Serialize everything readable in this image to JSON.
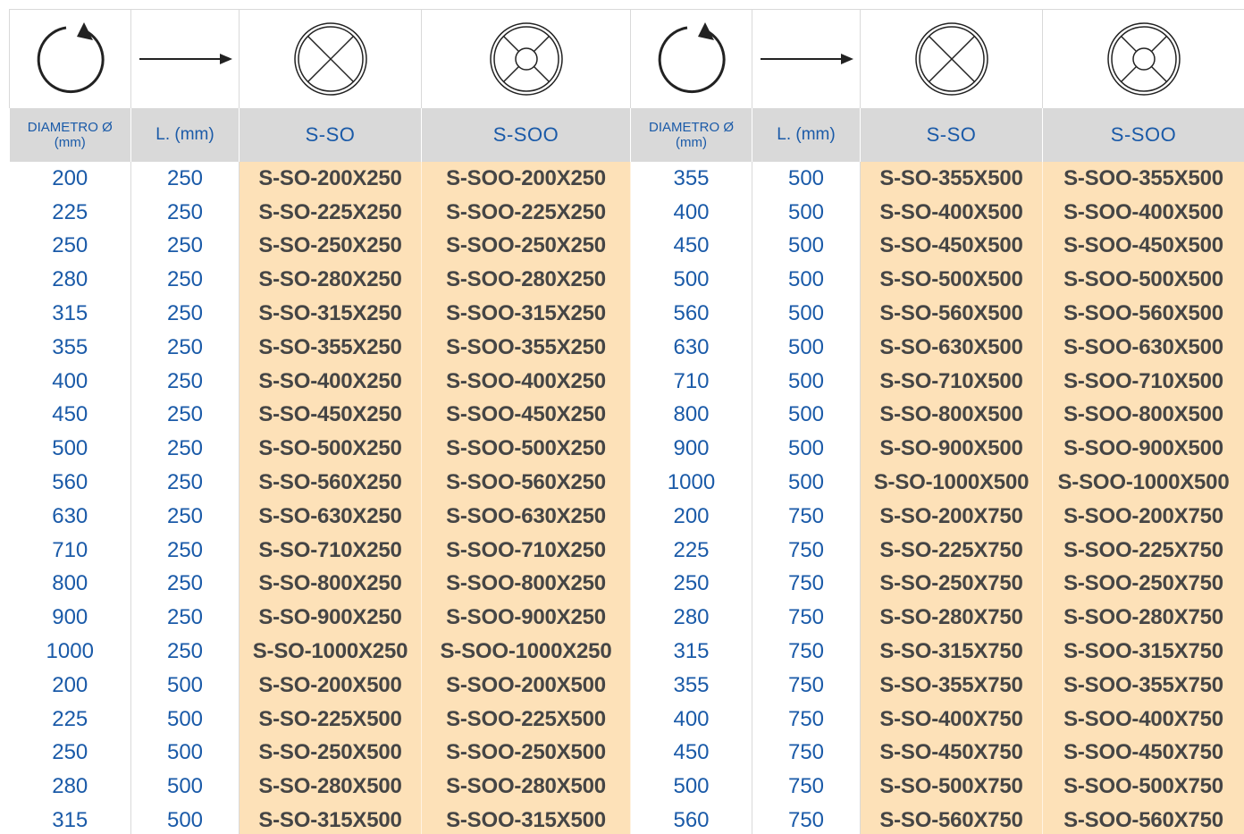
{
  "header": {
    "icons": [
      {
        "name": "rotation-arrow-icon"
      },
      {
        "name": "length-arrow-icon"
      },
      {
        "name": "cross-damper-icon"
      },
      {
        "name": "round-cross-damper-icon"
      },
      {
        "name": "rotation-arrow-icon"
      },
      {
        "name": "length-arrow-icon"
      },
      {
        "name": "cross-damper-icon"
      },
      {
        "name": "round-cross-damper-icon"
      }
    ],
    "labels": [
      {
        "line1": "DIAMETRO Ø",
        "line2": "(mm)"
      },
      {
        "text": "L. (mm)"
      },
      {
        "text": "S-SO"
      },
      {
        "text": "S-SOO"
      },
      {
        "line1": "DIAMETRO Ø",
        "line2": "(mm)"
      },
      {
        "text": "L. (mm)"
      },
      {
        "text": "S-SO"
      },
      {
        "text": "S-SOO"
      }
    ]
  },
  "colors": {
    "accent_blue": "#1a5aa8",
    "header_gray": "#d9d9d9",
    "code_background": "#fde1b8",
    "code_text": "#454545"
  },
  "rows": [
    [
      "200",
      "250",
      "S-SO-200X250",
      "S-SOO-200X250",
      "355",
      "500",
      "S-SO-355X500",
      "S-SOO-355X500"
    ],
    [
      "225",
      "250",
      "S-SO-225X250",
      "S-SOO-225X250",
      "400",
      "500",
      "S-SO-400X500",
      "S-SOO-400X500"
    ],
    [
      "250",
      "250",
      "S-SO-250X250",
      "S-SOO-250X250",
      "450",
      "500",
      "S-SO-450X500",
      "S-SOO-450X500"
    ],
    [
      "280",
      "250",
      "S-SO-280X250",
      "S-SOO-280X250",
      "500",
      "500",
      "S-SO-500X500",
      "S-SOO-500X500"
    ],
    [
      "315",
      "250",
      "S-SO-315X250",
      "S-SOO-315X250",
      "560",
      "500",
      "S-SO-560X500",
      "S-SOO-560X500"
    ],
    [
      "355",
      "250",
      "S-SO-355X250",
      "S-SOO-355X250",
      "630",
      "500",
      "S-SO-630X500",
      "S-SOO-630X500"
    ],
    [
      "400",
      "250",
      "S-SO-400X250",
      "S-SOO-400X250",
      "710",
      "500",
      "S-SO-710X500",
      "S-SOO-710X500"
    ],
    [
      "450",
      "250",
      "S-SO-450X250",
      "S-SOO-450X250",
      "800",
      "500",
      "S-SO-800X500",
      "S-SOO-800X500"
    ],
    [
      "500",
      "250",
      "S-SO-500X250",
      "S-SOO-500X250",
      "900",
      "500",
      "S-SO-900X500",
      "S-SOO-900X500"
    ],
    [
      "560",
      "250",
      "S-SO-560X250",
      "S-SOO-560X250",
      "1000",
      "500",
      "S-SO-1000X500",
      "S-SOO-1000X500"
    ],
    [
      "630",
      "250",
      "S-SO-630X250",
      "S-SOO-630X250",
      "200",
      "750",
      "S-SO-200X750",
      "S-SOO-200X750"
    ],
    [
      "710",
      "250",
      "S-SO-710X250",
      "S-SOO-710X250",
      "225",
      "750",
      "S-SO-225X750",
      "S-SOO-225X750"
    ],
    [
      "800",
      "250",
      "S-SO-800X250",
      "S-SOO-800X250",
      "250",
      "750",
      "S-SO-250X750",
      "S-SOO-250X750"
    ],
    [
      "900",
      "250",
      "S-SO-900X250",
      "S-SOO-900X250",
      "280",
      "750",
      "S-SO-280X750",
      "S-SOO-280X750"
    ],
    [
      "1000",
      "250",
      "S-SO-1000X250",
      "S-SOO-1000X250",
      "315",
      "750",
      "S-SO-315X750",
      "S-SOO-315X750"
    ],
    [
      "200",
      "500",
      "S-SO-200X500",
      "S-SOO-200X500",
      "355",
      "750",
      "S-SO-355X750",
      "S-SOO-355X750"
    ],
    [
      "225",
      "500",
      "S-SO-225X500",
      "S-SOO-225X500",
      "400",
      "750",
      "S-SO-400X750",
      "S-SOO-400X750"
    ],
    [
      "250",
      "500",
      "S-SO-250X500",
      "S-SOO-250X500",
      "450",
      "750",
      "S-SO-450X750",
      "S-SOO-450X750"
    ],
    [
      "280",
      "500",
      "S-SO-280X500",
      "S-SOO-280X500",
      "500",
      "750",
      "S-SO-500X750",
      "S-SOO-500X750"
    ],
    [
      "315",
      "500",
      "S-SO-315X500",
      "S-SOO-315X500",
      "560",
      "750",
      "S-SO-560X750",
      "S-SOO-560X750"
    ]
  ]
}
